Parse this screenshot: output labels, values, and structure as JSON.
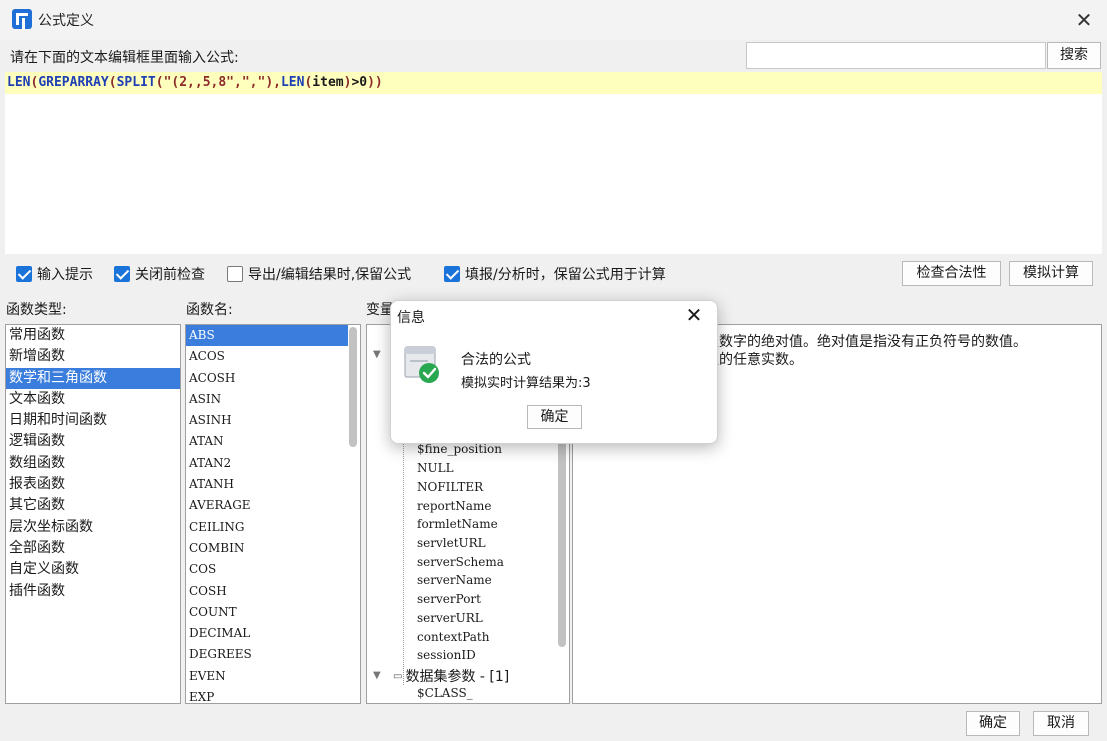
{
  "window": {
    "title": "公式定义",
    "close": "✕"
  },
  "editor": {
    "prompt": "请在下面的文本编辑框里面输入公式:",
    "search_value": "",
    "search_button": "搜索",
    "formula": "LEN(GREPARRAY(SPLIT(\"(2,,5,8\",\",\"),LEN(item)>0))"
  },
  "options": [
    {
      "label": "输入提示",
      "checked": true
    },
    {
      "label": "关闭前检查",
      "checked": true
    },
    {
      "label": "导出/编辑结果时,保留公式",
      "checked": false
    },
    {
      "label": "填报/分析时，保留公式用于计算",
      "checked": true
    }
  ],
  "buttons": {
    "check": "检查合法性",
    "simulate": "模拟计算",
    "ok": "确定",
    "cancel": "取消"
  },
  "labels": {
    "types": "函数类型:",
    "funcs": "函数名:",
    "vars": "变量"
  },
  "function_types": [
    "常用函数",
    "新增函数",
    "数学和三角函数",
    "文本函数",
    "日期和时间函数",
    "逻辑函数",
    "数组函数",
    "报表函数",
    "其它函数",
    "层次坐标函数",
    "全部函数",
    "自定义函数",
    "插件函数"
  ],
  "selected_type": 2,
  "function_names": [
    "ABS",
    "ACOS",
    "ACOSH",
    "ASIN",
    "ASINH",
    "ATAN",
    "ATAN2",
    "ATANH",
    "AVERAGE",
    "CEILING",
    "COMBIN",
    "COS",
    "COSH",
    "COUNT",
    "DECIMAL",
    "DEGREES",
    "EVEN",
    "EXP"
  ],
  "selected_function": 0,
  "variables": [
    "$fine_position",
    "NULL",
    "NOFILTER",
    "reportName",
    "formletName",
    "servletURL",
    "serverSchema",
    "serverName",
    "serverPort",
    "serverURL",
    "contextPath",
    "sessionID"
  ],
  "dataset_node": "数据集参数 - [1]",
  "dataset_child": "$CLASS_",
  "description": {
    "line1": "定数字的绝对值。绝对值是指没有正负符号的数值。",
    "line2": "值的任意实数。"
  },
  "dialog": {
    "title": "信息",
    "message": "合法的公式",
    "result": "模拟实时计算结果为:3",
    "ok": "确定"
  }
}
